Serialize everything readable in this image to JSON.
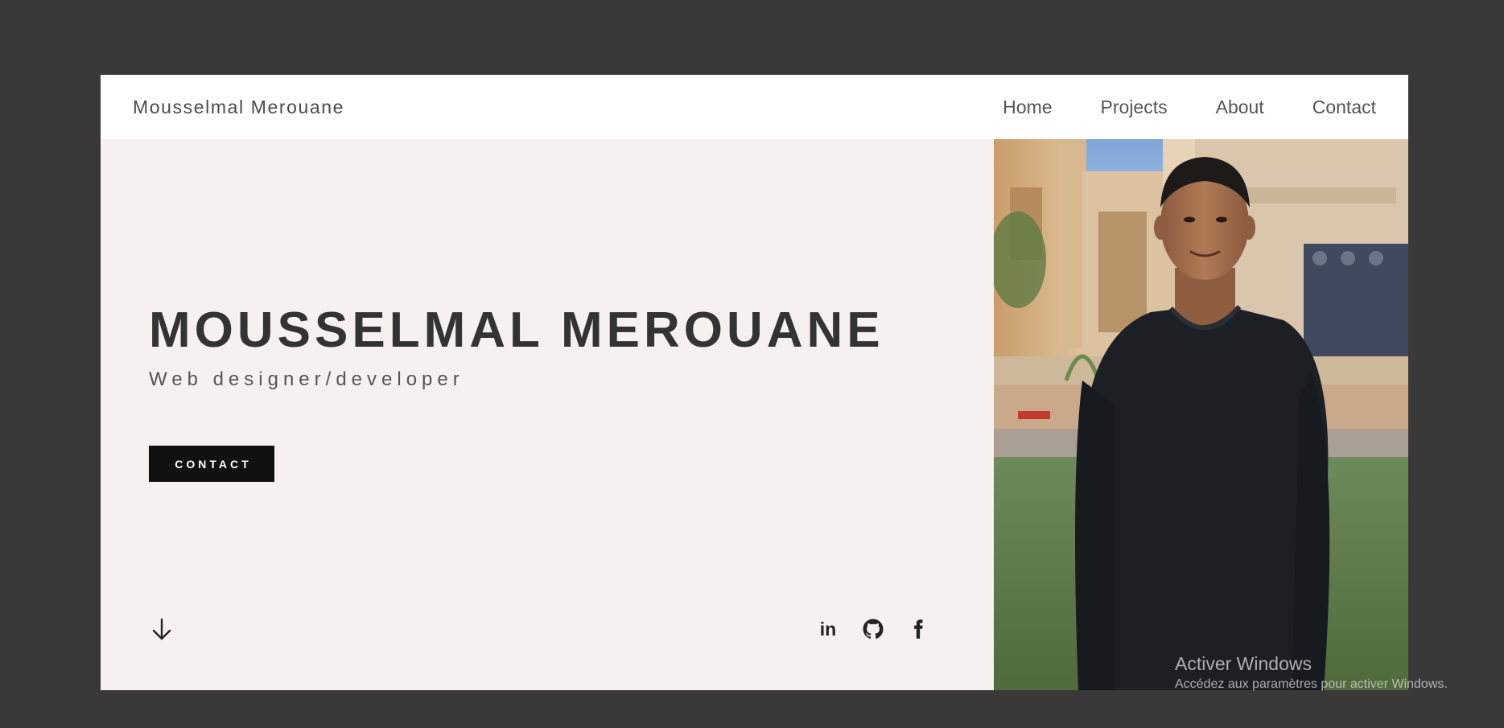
{
  "header": {
    "brand": "Mousselmal Merouane",
    "nav": [
      {
        "label": "Home"
      },
      {
        "label": "Projects"
      },
      {
        "label": "About"
      },
      {
        "label": "Contact"
      }
    ]
  },
  "hero": {
    "title": "MOUSSELMAL MEROUANE",
    "subtitle": "Web designer/developer",
    "contact_button": "CONTACT",
    "scroll_icon": "arrow-down-icon",
    "social": [
      {
        "icon": "linkedin-icon",
        "text": "in"
      },
      {
        "icon": "github-icon"
      },
      {
        "icon": "facebook-icon"
      }
    ]
  },
  "profile_photo": {
    "icon": "portrait-photo"
  },
  "watermark": {
    "title": "Activer Windows",
    "subtitle": "Accédez aux paramètres pour activer Windows."
  },
  "colors": {
    "page_background": "#3a3839",
    "hero_background": "#f6f0f0",
    "button_background": "#111111",
    "text_dark": "#333333"
  }
}
